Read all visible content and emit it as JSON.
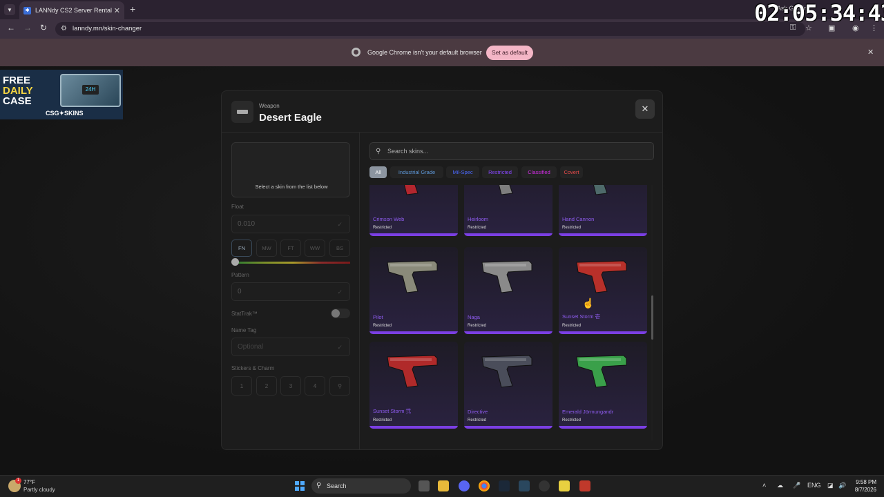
{
  "browser": {
    "tab_title": "LANNdy CS2 Server Rental",
    "url": "lanndy.mn/skin-changer",
    "ask_gemini": "Ask Gemini",
    "infobar_text": "Google Chrome isn't your default browser",
    "set_default_label": "Set as default"
  },
  "overlay_clock": "02:05:34:43",
  "ad": {
    "line1": "FREE",
    "line2": "DAILY",
    "line3": "CASE",
    "badge": "24H",
    "brand": "CSG✦SKINS"
  },
  "modal": {
    "weapon_label": "Weapon",
    "weapon_name": "Desert Eagle",
    "close_icon": "✕",
    "preview_text": "Select a skin from the list below",
    "float_label": "Float",
    "float_value": "0.010",
    "wear_buttons": [
      "FN",
      "MW",
      "FT",
      "WW",
      "BS"
    ],
    "pattern_label": "Pattern",
    "pattern_value": "0",
    "stattrak_label": "StatTrak™",
    "nametag_label": "Name Tag",
    "nametag_placeholder": "Optional",
    "stickers_label": "Stickers & Charm",
    "sticker_slots": [
      "1",
      "2",
      "3",
      "4"
    ],
    "search_placeholder": "Search skins...",
    "filters": [
      {
        "label": "All",
        "color": "#9aa3ad"
      },
      {
        "label": "Industrial Grade",
        "color": "#5e98d9"
      },
      {
        "label": "Mil-Spec",
        "color": "#4b69ff"
      },
      {
        "label": "Restricted",
        "color": "#8847ff"
      },
      {
        "label": "Classified",
        "color": "#d32ce6"
      },
      {
        "label": "Covert",
        "color": "#eb4b4b"
      }
    ],
    "skins": [
      {
        "name": "Crimson Web",
        "rarity": "Restricted",
        "color": "#b3262e"
      },
      {
        "name": "Heirloom",
        "rarity": "Restricted",
        "color": "#7e7e7e"
      },
      {
        "name": "Hand Cannon",
        "rarity": "Restricted",
        "color": "#4e6a6a"
      },
      {
        "name": "Pilot",
        "rarity": "Restricted",
        "color": "#8a8a7a"
      },
      {
        "name": "Naga",
        "rarity": "Restricted",
        "color": "#8a8a8a"
      },
      {
        "name": "Sunset Storm 壱",
        "rarity": "Restricted",
        "color": "#b8302a"
      },
      {
        "name": "Sunset Storm 弐",
        "rarity": "Restricted",
        "color": "#b02a2a"
      },
      {
        "name": "Directive",
        "rarity": "Restricted",
        "color": "#4a4d5a"
      },
      {
        "name": "Emerald Jörmungandr",
        "rarity": "Restricted",
        "color": "#3aa04a"
      }
    ]
  },
  "taskbar": {
    "weather_temp": "77°F",
    "weather_desc": "Partly cloudy",
    "search_label": "Search",
    "lang": "ENG",
    "time": "9:58 PM",
    "date": "8/7/2026"
  }
}
